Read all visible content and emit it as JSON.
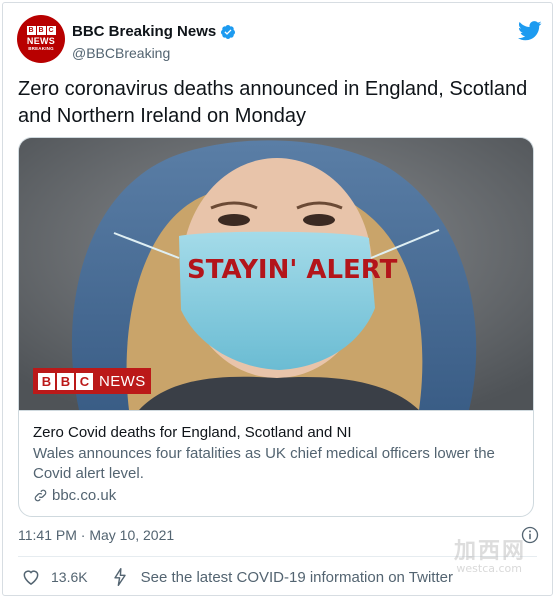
{
  "account": {
    "display_name": "BBC Breaking News",
    "handle": "@BBCBreaking",
    "avatar_text": {
      "blocks": [
        "B",
        "B",
        "C"
      ],
      "word": "NEWS",
      "sub": "BREAKING"
    }
  },
  "tweet": {
    "text": "Zero coronavirus deaths announced in England, Scotland and Northern Ireland on Monday",
    "timestamp": "11:41 PM · May 10, 2021"
  },
  "card": {
    "image_mask_text": "STAYIN' ALERT",
    "image_logo": {
      "blocks": [
        "B",
        "B",
        "C"
      ],
      "word": "NEWS"
    },
    "title": "Zero Covid deaths for England, Scotland and NI",
    "description": "Wales announces four fatalities as UK chief medical officers lower the Covid alert level.",
    "domain": "bbc.co.uk"
  },
  "actions": {
    "like_count": "13.6K",
    "covid_info": "See the latest COVID-19 information on Twitter"
  },
  "watermark": {
    "main": "加西网",
    "sub": "westca.com"
  },
  "colors": {
    "twitter_blue": "#1d9bf0",
    "bbc_red": "#bb1919",
    "secondary_text": "#536471"
  },
  "icons": [
    "verified-badge-icon",
    "twitter-bird-icon",
    "link-icon",
    "info-icon",
    "heart-icon",
    "lightning-icon"
  ]
}
